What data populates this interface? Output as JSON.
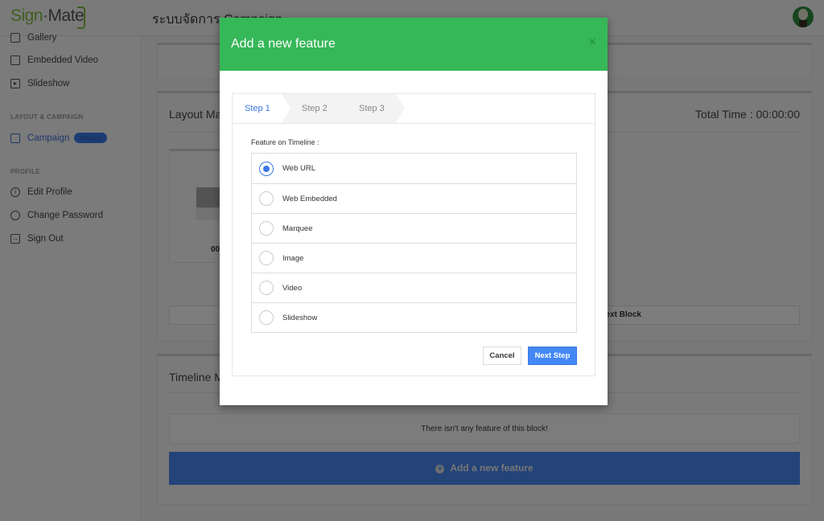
{
  "header": {
    "logo": "Sign-Mate",
    "logo_left": "Sign",
    "logo_right": "Mate",
    "title": "ระบบจัดการ Campaign"
  },
  "sidebar": {
    "items_top": [
      {
        "label": "Gallery",
        "icon": "image-icon"
      },
      {
        "label": "Embedded Video",
        "icon": "video-library-icon"
      },
      {
        "label": "Slideshow",
        "icon": "play-icon"
      }
    ],
    "section_layout": "LAYOUT & CAMPAIGN",
    "campaign": {
      "label": "Campaign",
      "badge": "Manage",
      "icon": "monitor-icon",
      "active": true
    },
    "section_profile": "PROFILE",
    "profile_items": [
      {
        "label": "Edit Profile",
        "icon": "info-icon"
      },
      {
        "label": "Change Password",
        "icon": "key-icon"
      },
      {
        "label": "Sign Out",
        "icon": "sign-out-icon"
      }
    ]
  },
  "main": {
    "layout_title": "Layout Ma",
    "total_time": "Total Time : 00:00:00",
    "thumb_time": "00",
    "next_block": "Next Block",
    "timeline_title": "Timeline M",
    "empty_message": "There isn't any feature of this block!",
    "add_feature": "Add a new feature"
  },
  "modal": {
    "title": "Add a new feature",
    "close": "×",
    "steps": [
      "Step 1",
      "Step 2",
      "Step 3"
    ],
    "active_step": 1,
    "field_label": "Feature on Timeline :",
    "options": [
      "Web URL",
      "Web Embedded",
      "Marquee",
      "Image",
      "Video",
      "Slideshow"
    ],
    "selected": "Web URL",
    "cancel": "Cancel",
    "next": "Next Step"
  },
  "colors": {
    "modal_header": "#36b758",
    "primary": "#4488f6",
    "add_button": "#4686f2"
  }
}
